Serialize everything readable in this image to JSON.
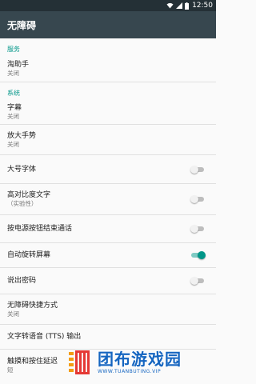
{
  "status_bar": {
    "time": "12:50",
    "icons": [
      "wifi-icon",
      "signal-icon",
      "battery-icon"
    ]
  },
  "app_bar": {
    "title": "无障碍"
  },
  "sections": [
    {
      "header": "服务",
      "items": [
        {
          "title": "淘助手",
          "summary": "关闭"
        }
      ]
    },
    {
      "header": "系统",
      "items": [
        {
          "title": "字幕",
          "summary": "关闭"
        },
        {
          "title": "放大手势",
          "summary": "关闭"
        },
        {
          "title": "大号字体",
          "switch": "off"
        },
        {
          "title": "高对比度文字",
          "summary": "（实验性）",
          "switch": "off"
        },
        {
          "title": "按电源按钮结束通话",
          "switch": "off"
        },
        {
          "title": "自动旋转屏幕",
          "switch": "on"
        },
        {
          "title": "说出密码",
          "switch": "off"
        },
        {
          "title": "无障碍快捷方式",
          "summary": "关闭"
        },
        {
          "title": "文字转语音 (TTS) 输出"
        },
        {
          "title": "触摸和按住延迟",
          "summary": "短"
        }
      ]
    }
  ],
  "watermark": {
    "brand": "团布游戏园",
    "url": "WWW.TUANBUTING.VIP"
  },
  "colors": {
    "accent": "#009688",
    "app_bar": "#37474f",
    "status_bar": "#243036"
  }
}
